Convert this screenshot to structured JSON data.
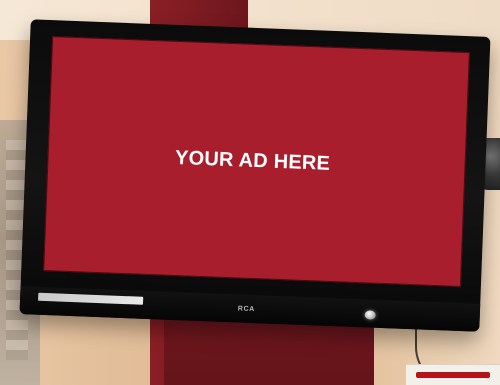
{
  "tv_screen": {
    "ad_text": "YOUR AD HERE",
    "background_color": "#a91e2c"
  },
  "tv": {
    "brand_logo": "RCA"
  }
}
